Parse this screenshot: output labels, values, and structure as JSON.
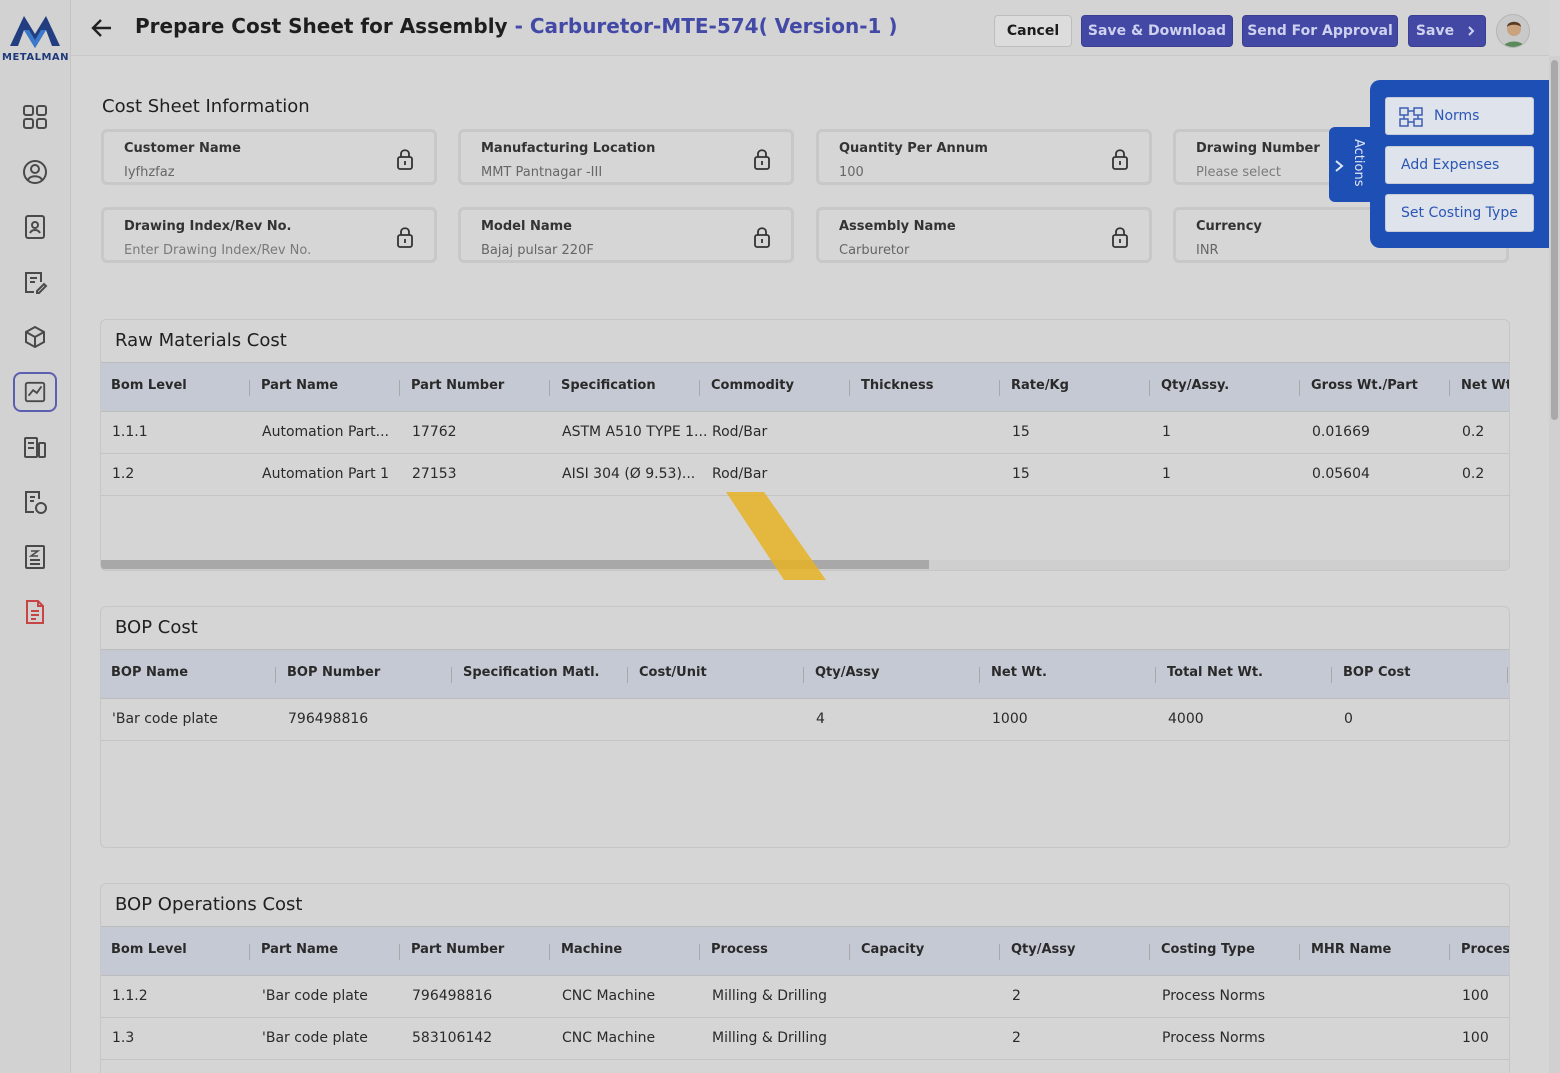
{
  "brand": {
    "logo_text": "METALMAN"
  },
  "header": {
    "title": "Prepare Cost Sheet for Assembly",
    "subtitle": "- Carburetor-MTE-574( Version-1 )",
    "cancel_label": "Cancel",
    "save_download_label": "Save & Download",
    "send_approval_label": "Send For Approval",
    "save_label": "Save"
  },
  "sidebar": {
    "items": [
      {
        "icon": "dashboard-icon"
      },
      {
        "icon": "user-icon"
      },
      {
        "icon": "contacts-icon"
      },
      {
        "icon": "edit-document-icon"
      },
      {
        "icon": "box-icon"
      },
      {
        "icon": "chart-icon",
        "active": true
      },
      {
        "icon": "machines-icon"
      },
      {
        "icon": "cost-icon"
      },
      {
        "icon": "zbc-icon"
      },
      {
        "icon": "report-icon"
      }
    ]
  },
  "info": {
    "title": "Cost Sheet Information",
    "fields": [
      {
        "label": "Customer Name",
        "value": "Iyfhzfaz"
      },
      {
        "label": "Manufacturing Location",
        "value": "MMT Pantnagar -III"
      },
      {
        "label": "Quantity Per Annum",
        "value": "100"
      },
      {
        "label": "Drawing Number",
        "value": "Please select"
      },
      {
        "label": "Drawing Index/Rev No.",
        "placeholder": "Enter Drawing Index/Rev No."
      },
      {
        "label": "Model Name",
        "value": "Bajaj pulsar 220F"
      },
      {
        "label": "Assembly Name",
        "value": "Carburetor"
      },
      {
        "label": "Currency",
        "value": "INR"
      }
    ]
  },
  "actions": {
    "tab_label": "Actions",
    "norms_label": "Norms",
    "add_expenses_label": "Add Expenses",
    "set_costing_type_label": "Set Costing Type"
  },
  "raw_materials": {
    "title": "Raw Materials Cost",
    "columns": [
      "Bom Level",
      "Part Name",
      "Part Number",
      "Specification",
      "Commodity",
      "Thickness",
      "Rate/Kg",
      "Qty/Assy.",
      "Gross Wt./Part",
      "Net Wt."
    ],
    "rows": [
      [
        "1.1.1",
        "Automation Part...",
        "17762",
        "ASTM A510 TYPE 1...",
        "Rod/Bar",
        "",
        "15",
        "1",
        "0.01669",
        "0.2"
      ],
      [
        "1.2",
        "Automation Part 1",
        "27153",
        "AISI 304 (Ø 9.53)...",
        "Rod/Bar",
        "",
        "15",
        "1",
        "0.05604",
        "0.2"
      ]
    ]
  },
  "bop": {
    "title": "BOP Cost",
    "columns": [
      "BOP Name",
      "BOP Number",
      "Specification Matl.",
      "Cost/Unit",
      "Qty/Assy",
      "Net Wt.",
      "Total Net Wt.",
      "BOP Cost"
    ],
    "rows": [
      [
        "'Bar code plate",
        "796498816",
        "",
        "",
        "4",
        "1000",
        "4000",
        "0"
      ]
    ]
  },
  "bop_ops": {
    "title": "BOP Operations Cost",
    "columns": [
      "Bom Level",
      "Part Name",
      "Part Number",
      "Machine",
      "Process",
      "Capacity",
      "Qty/Assy",
      "Costing Type",
      "MHR Name",
      "Process"
    ],
    "rows": [
      [
        "1.1.2",
        "'Bar code plate",
        "796498816",
        "CNC Machine",
        "Milling & Drilling",
        "",
        "2",
        "Process Norms",
        "",
        "100"
      ],
      [
        "1.3",
        "'Bar code plate",
        "583106142",
        "CNC Machine",
        "Milling & Drilling",
        "",
        "2",
        "Process Norms",
        "",
        "100"
      ]
    ]
  },
  "colors": {
    "primary": "#4248a4",
    "actions_panel": "#1e4fb5",
    "highlight": "#e6b324"
  }
}
